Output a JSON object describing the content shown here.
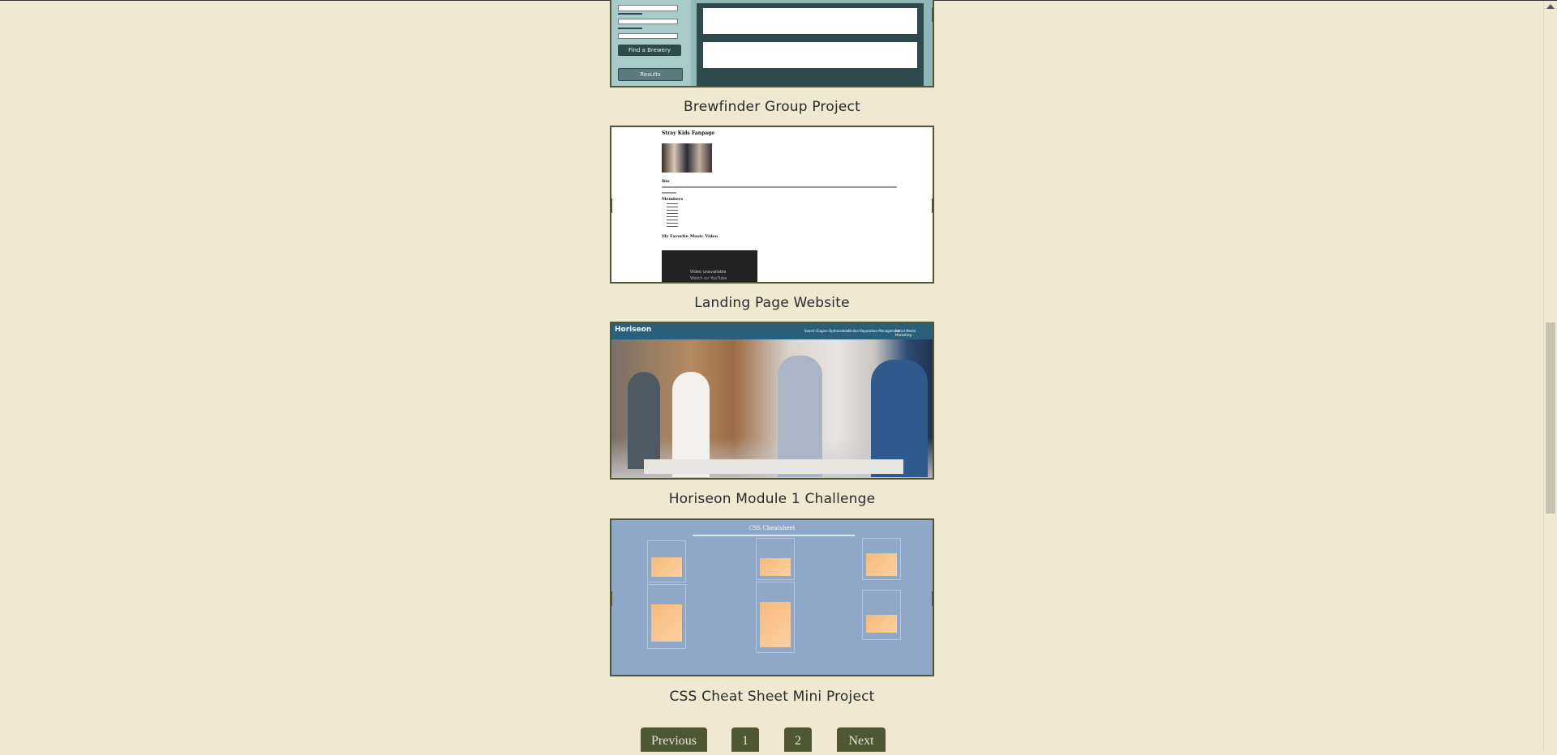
{
  "projects": [
    {
      "title": "Brewfinder Group Project",
      "preview": {
        "find_button": "Find a Brewery",
        "secondary_button": "Results"
      }
    },
    {
      "title": "Landing Page Website",
      "preview": {
        "heading": "Stray Kids Fanpage",
        "bio": "Bio",
        "members": "Members",
        "video": "My Favorite Music Video",
        "video_notice": "Video unavailable",
        "video_notice_2": "Watch on YouTube"
      }
    },
    {
      "title": "Horiseon Module 1 Challenge",
      "preview": {
        "brand": "Horiseon",
        "nav": [
          "Search Engine Optimization",
          "Online Reputation Management",
          "Social Media Marketing"
        ]
      }
    },
    {
      "title": "CSS Cheat Sheet Mini Project",
      "preview": {
        "heading": "CSS Cheatsheet"
      }
    }
  ],
  "pagination": {
    "previous": "Previous",
    "pages": [
      "1",
      "2"
    ],
    "next": "Next"
  },
  "colors": {
    "background": "#f0e8d0",
    "accent": "#4e5734"
  }
}
